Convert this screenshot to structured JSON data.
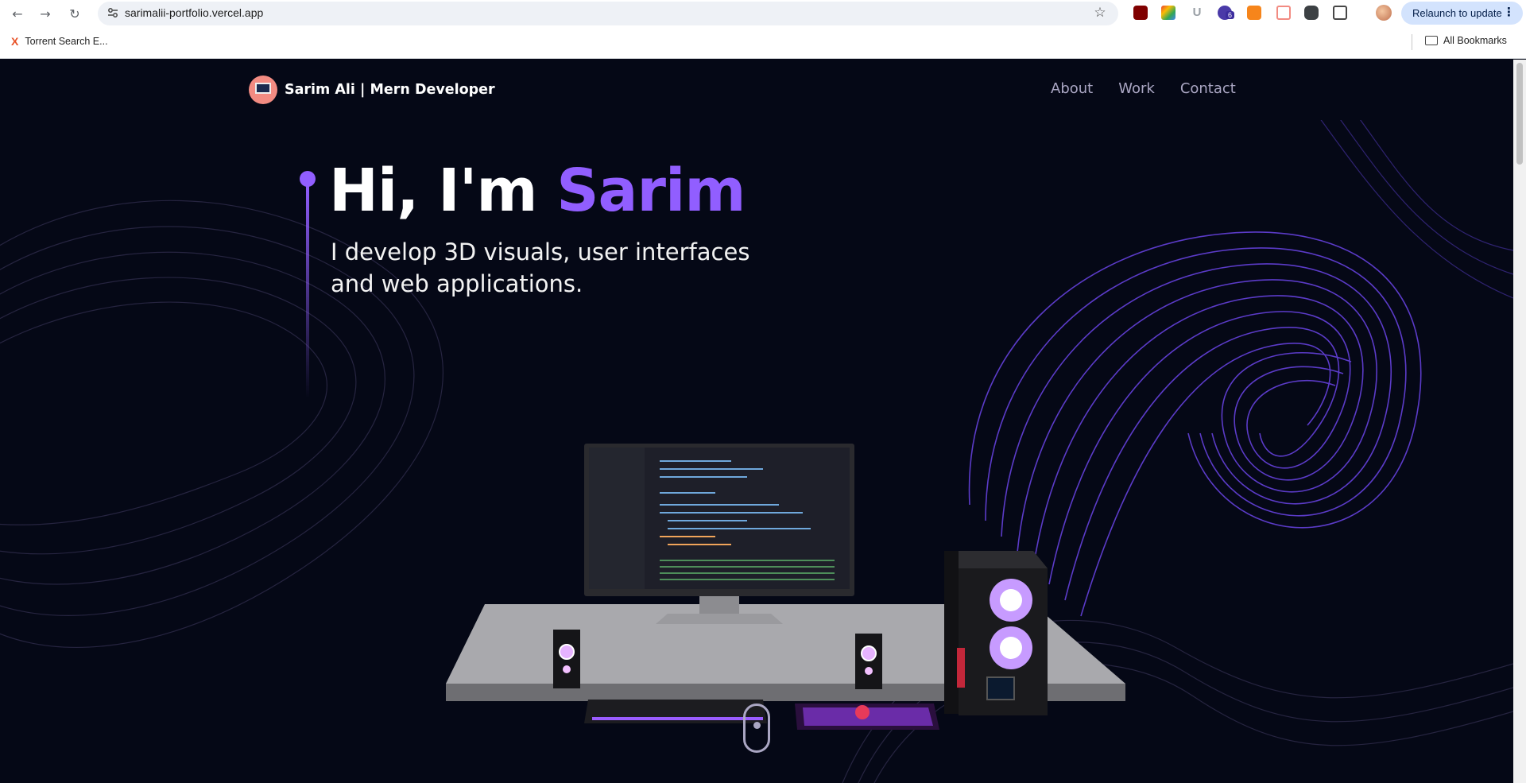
{
  "browser": {
    "url": "sarimalii-portfolio.vercel.app",
    "relaunch_label": "Relaunch to update",
    "extension_badge": "6",
    "bookmarks": [
      {
        "label": "Torrent Search E..."
      }
    ],
    "all_bookmarks_label": "All Bookmarks"
  },
  "site": {
    "logo_text": "Sarim Ali  | Mern Developer",
    "nav_links": [
      "About",
      "Work",
      "Contact"
    ]
  },
  "hero": {
    "greeting": "Hi, I'm ",
    "name": "Sarim",
    "subtitle": "I develop 3D visuals, user interfaces and web applications."
  },
  "colors": {
    "background": "#050816",
    "accent": "#915eff",
    "nav_text": "#aaa6c3"
  }
}
